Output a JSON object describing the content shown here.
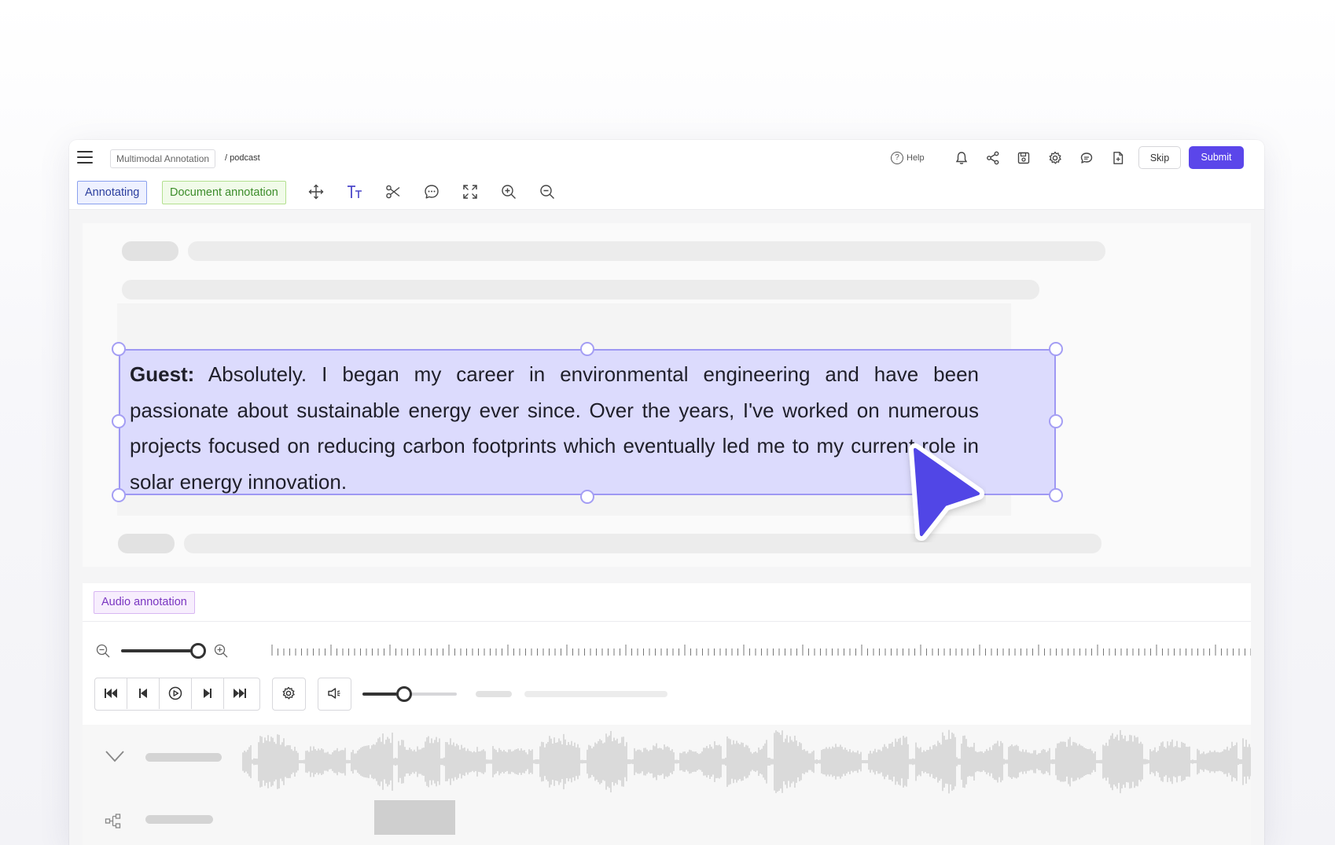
{
  "header": {
    "menu_icon": "hamburger-icon",
    "project": "Multimodal Annotation",
    "separator_path": "/ podcast",
    "help_label": "Help",
    "help_icon": "question-circle-icon",
    "skip_label": "Skip",
    "submit_label": "Submit",
    "icons": [
      "bell-icon",
      "share-icon",
      "save-icon",
      "gear-icon",
      "comments-icon",
      "document-icon"
    ]
  },
  "toolbar": {
    "mode_label": "Annotating",
    "doc_tag_label": "Document annotation",
    "tools": [
      "move-icon",
      "text-size-icon",
      "scissors-icon",
      "comment-icon",
      "fullscreen-icon",
      "zoom-in-icon",
      "zoom-out-icon"
    ]
  },
  "document": {
    "speaker": "Guest:",
    "selected_text": "Absolutely. I began my career in environmental engineering and have been passionate about sustainable energy ever since. Over the years, I've worked on numerous projects focused on reducing carbon footprints which eventually led me to my current role in solar energy innovation."
  },
  "audio": {
    "tag_label": "Audio annotation",
    "zoom_level": 1.0,
    "volume_level": 0.43,
    "transport": [
      "skip-back-icon",
      "step-back-icon",
      "play-icon",
      "step-forward-icon",
      "skip-forward-icon"
    ]
  },
  "colors": {
    "accent": "#5b46ea",
    "selection_fill": "#dcdbfd",
    "selection_border": "#9e98f3",
    "doc_tag_green": "#3c8c2a",
    "audio_tag_purple": "#7a36c1"
  }
}
